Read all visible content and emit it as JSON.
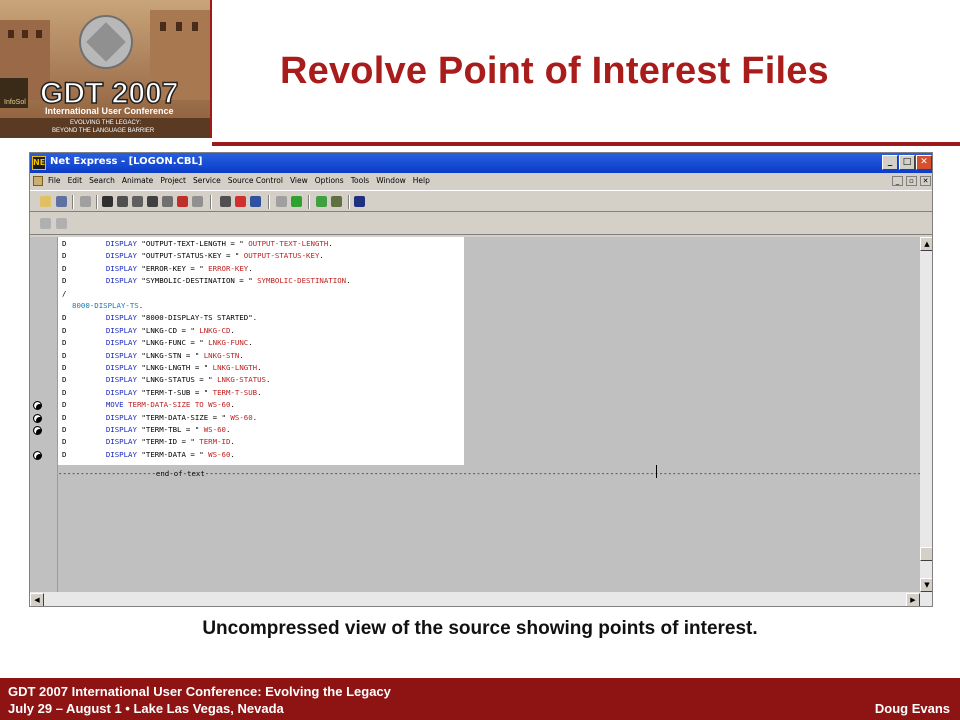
{
  "logo": {
    "main_text": "GDT 2007",
    "sub_text": "International User Conference",
    "tagline_1": "EVOLVING THE LEGACY:",
    "tagline_2": "BEYOND THE LANGUAGE BARRIER",
    "emblem_text": "InfoSol"
  },
  "slide": {
    "title": "Revolve Point of Interest Files",
    "caption": "Uncompressed view of the source showing points of interest."
  },
  "window": {
    "title": "Net Express - [LOGON.CBL]",
    "menu": [
      "File",
      "Edit",
      "Search",
      "Animate",
      "Project",
      "Service",
      "Source Control",
      "View",
      "Options",
      "Tools",
      "Window",
      "Help"
    ],
    "end_of_text": "end-of-text"
  },
  "code_lines": [
    {
      "flag": "D",
      "pre": "",
      "kw": "DISPLAY",
      "str": " \"OUTPUT-TEXT-LENGTH = \" ",
      "var": "OUTPUT-TEXT-LENGTH",
      "end": "."
    },
    {
      "flag": "D",
      "pre": "",
      "kw": "DISPLAY",
      "str": " \"OUTPUT-STATUS-KEY = \" ",
      "var": "OUTPUT-STATUS-KEY",
      "end": "."
    },
    {
      "flag": "D",
      "pre": "",
      "kw": "DISPLAY",
      "str": " \"ERROR-KEY = \" ",
      "var": "ERROR-KEY",
      "end": "."
    },
    {
      "flag": "D",
      "pre": "",
      "kw": "DISPLAY",
      "str": " \"SYMBOLIC-DESTINATION = \" ",
      "var": "SYMBOLIC-DESTINATION",
      "end": "."
    },
    {
      "flag": "/",
      "pre": "",
      "kw": "",
      "str": "",
      "var": "",
      "end": ""
    },
    {
      "flag": "",
      "pre": "8000-DISPLAY-TS",
      "kw": "",
      "str": "",
      "var": "",
      "end": "."
    },
    {
      "flag": "D",
      "pre": "",
      "kw": "DISPLAY",
      "str": " \"8000-DISPLAY-TS STARTED\"",
      "var": "",
      "end": "."
    },
    {
      "flag": "D",
      "pre": "",
      "kw": "DISPLAY",
      "str": " \"LNKG-CD = \" ",
      "var": "LNKG-CD",
      "end": "."
    },
    {
      "flag": "D",
      "pre": "",
      "kw": "DISPLAY",
      "str": " \"LNKG-FUNC = \" ",
      "var": "LNKG-FUNC",
      "end": "."
    },
    {
      "flag": "D",
      "pre": "",
      "kw": "DISPLAY",
      "str": " \"LNKG-STN = \" ",
      "var": "LNKG-STN",
      "end": "."
    },
    {
      "flag": "D",
      "pre": "",
      "kw": "DISPLAY",
      "str": " \"LNKG-LNGTH = \" ",
      "var": "LNKG-LNGTH",
      "end": "."
    },
    {
      "flag": "D",
      "pre": "",
      "kw": "DISPLAY",
      "str": " \"LNKG-STATUS = \" ",
      "var": "LNKG-STATUS",
      "end": "."
    },
    {
      "flag": "D",
      "pre": "",
      "kw": "DISPLAY",
      "str": " \"TERM-T-SUB = \" ",
      "var": "TERM-T-SUB",
      "end": "."
    },
    {
      "flag": "D",
      "pre": "",
      "kw": "MOVE",
      "str": " ",
      "var": "TERM-DATA-SIZE TO WS-60",
      "end": "."
    },
    {
      "flag": "D",
      "pre": "",
      "kw": "DISPLAY",
      "str": " \"TERM-DATA-SIZE = \" ",
      "var": "WS-60",
      "end": "."
    },
    {
      "flag": "D",
      "pre": "",
      "kw": "DISPLAY",
      "str": " \"TERM-TBL = \" ",
      "var": "WS-60",
      "end": "."
    },
    {
      "flag": "D",
      "pre": "",
      "kw": "DISPLAY",
      "str": " \"TERM-ID = \" ",
      "var": "TERM-ID",
      "end": "."
    },
    {
      "flag": "D",
      "pre": "",
      "kw": "DISPLAY",
      "str": " \"TERM-DATA = \" ",
      "var": "WS-60",
      "end": "."
    }
  ],
  "breakpoint_lines": [
    13,
    14,
    15,
    17
  ],
  "footer": {
    "line1": "GDT 2007 International User Conference: Evolving the Legacy",
    "line2": "July 29 – August 1  •  Lake Las Vegas, Nevada",
    "author": "Doug Evans"
  },
  "colors": {
    "title": "#a81c1c",
    "footer_bg": "#8e1414",
    "keyword": "#1a2bc0",
    "variable": "#c02020"
  }
}
